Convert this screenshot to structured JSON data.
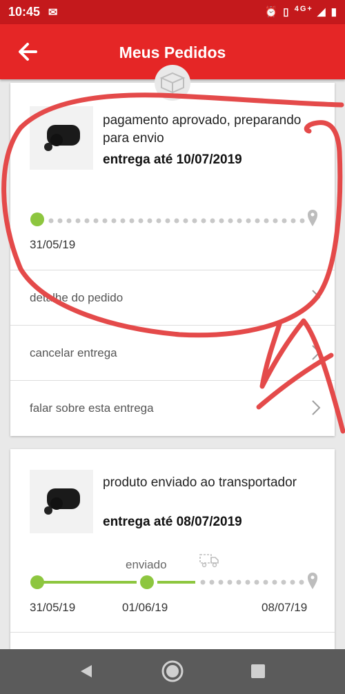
{
  "status_bar": {
    "time": "10:45",
    "network": "4G+"
  },
  "header": {
    "title": "Meus Pedidos"
  },
  "orders": [
    {
      "status": "pagamento aprovado, preparando para envio",
      "delivery": "entrega até 10/07/2019",
      "timeline": {
        "start_date": "31/05/19"
      },
      "actions": [
        "detalhe do pedido",
        "cancelar entrega",
        "falar sobre esta entrega"
      ]
    },
    {
      "status": "produto enviado ao transportador",
      "delivery": "entrega até 08/07/2019",
      "timeline": {
        "stage_label": "enviado",
        "dates": [
          "31/05/19",
          "01/06/19",
          "08/07/19"
        ]
      }
    }
  ],
  "colors": {
    "status_bar": "#c4191c",
    "app_bar": "#e52626",
    "progress": "#8dc63f",
    "pending_dot": "#c8c8c8",
    "nav_bar": "#5b5b5b",
    "annotation": "#e44a4a"
  },
  "icons": [
    "back-arrow-icon",
    "box-icon",
    "location-pin-icon",
    "chevron-right-icon",
    "truck-icon",
    "nav-back-icon",
    "nav-home-icon",
    "nav-recents-icon"
  ]
}
